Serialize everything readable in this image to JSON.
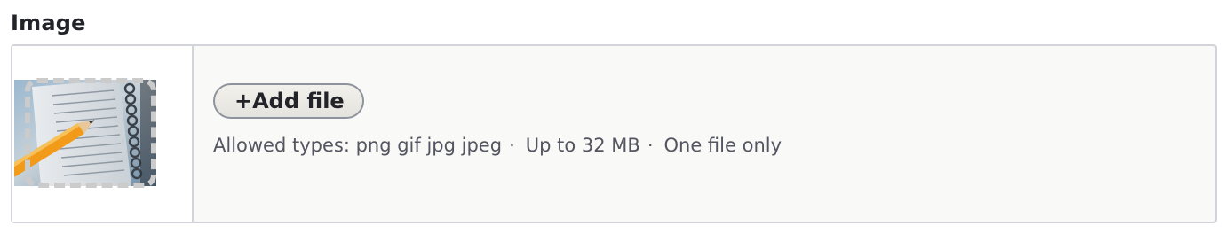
{
  "field": {
    "label": "Image"
  },
  "upload": {
    "add_button_label": "+Add file",
    "allowed_types": "Allowed types: png gif jpg jpeg",
    "max_size": "Up to 32 MB",
    "file_limit": "One file only",
    "separator": "·"
  },
  "preview": {
    "thumbnail_icon": "image-thumbnail"
  }
}
